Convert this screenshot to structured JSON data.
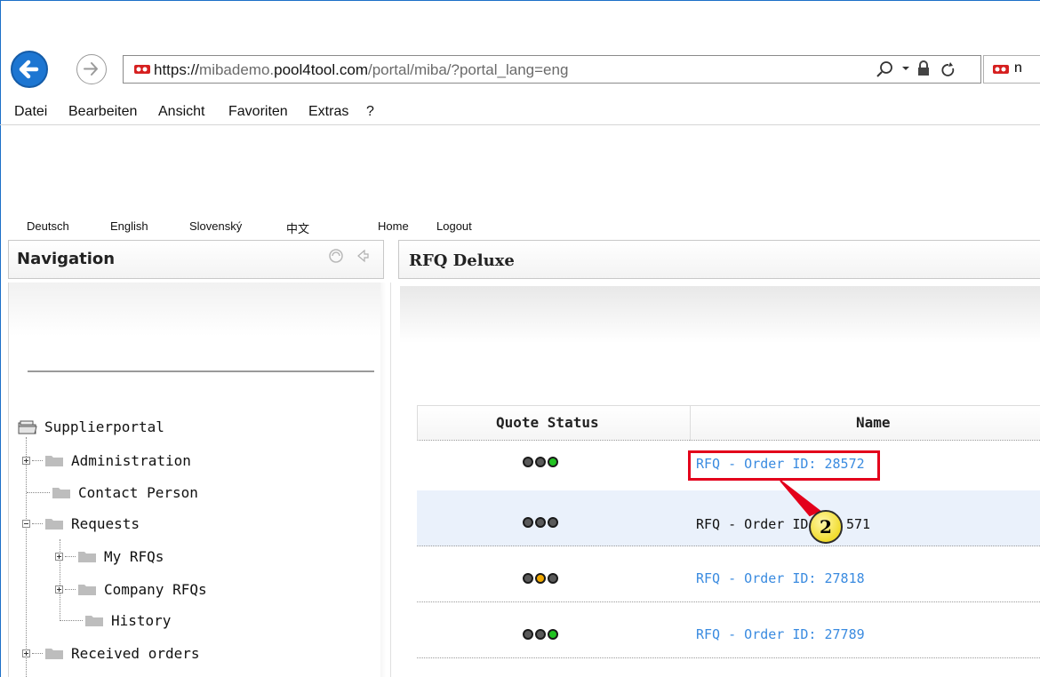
{
  "browser": {
    "url_protocol": "https://",
    "url_subdomain": "mibademo.",
    "url_host": "pool4tool.com",
    "url_path": "/portal/miba/?portal_lang=eng",
    "url_controls": "⌕ ▾ 🔒 ↻",
    "tab_fragment": "n"
  },
  "menubar": {
    "items": [
      "Datei",
      "Bearbeiten",
      "Ansicht",
      "Favoriten",
      "Extras",
      "?"
    ]
  },
  "top_links": {
    "languages": [
      "Deutsch",
      "English",
      "Slovenský",
      "中文"
    ],
    "home": "Home",
    "logout": "Logout"
  },
  "navigation": {
    "title": "Navigation",
    "root": "Supplierportal",
    "items": {
      "administration": "Administration",
      "contact_person": "Contact Person",
      "requests": "Requests",
      "my_rfqs": "My RFQs",
      "company_rfqs": "Company RFQs",
      "history": "History",
      "received_orders": "Received orders"
    }
  },
  "content": {
    "title": "RFQ Deluxe",
    "columns": [
      "Quote Status",
      "Name"
    ],
    "rows": [
      {
        "name": "RFQ - Order ID: 28572",
        "lights": [
          "#5a5a5a",
          "#5a5a5a",
          "#22c322"
        ],
        "link": true
      },
      {
        "name_left": "RFQ - Order ID",
        "name_right": "571",
        "lights": [
          "#5a5a5a",
          "#5a5a5a",
          "#5a5a5a"
        ],
        "link": false
      },
      {
        "name": "RFQ - Order ID: 27818",
        "lights": [
          "#5a5a5a",
          "#f0a800",
          "#5a5a5a"
        ],
        "link": true
      },
      {
        "name": "RFQ - Order ID: 27789",
        "lights": [
          "#5a5a5a",
          "#5a5a5a",
          "#22c322"
        ],
        "link": true
      }
    ]
  },
  "annotation": {
    "callout_number": "2",
    "highlight_color": "#e3001b"
  }
}
